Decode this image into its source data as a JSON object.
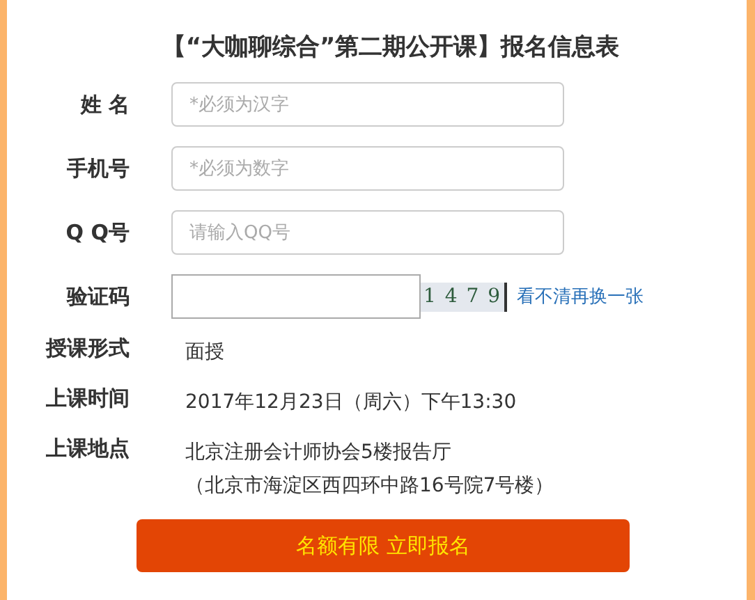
{
  "title": "【“大咖聊综合”第二期公开课】报名信息表",
  "fields": [
    {
      "label": "姓 名",
      "placeholder": "*必须为汉字",
      "kind": "text"
    },
    {
      "label": "手机号",
      "placeholder": "*必须为数字",
      "kind": "text"
    },
    {
      "label": "Q Q号",
      "placeholder": "请输入QQ号",
      "kind": "text"
    },
    {
      "label": "验证码",
      "kind": "captcha",
      "captcha": "1 4 7 9",
      "refresh_link": "看不清再换一张"
    }
  ],
  "info": [
    {
      "label": "授课形式",
      "lines": [
        "面授"
      ]
    },
    {
      "label": "上课时间",
      "lines": [
        "2017年12月23日（周六）下午13:30"
      ]
    },
    {
      "label": "上课地点",
      "lines": [
        "北京注册会计师协会5楼报告厅",
        "（北京市海淀区西四环中路16号院7号楼）"
      ]
    }
  ],
  "submit": "名额有限 立即报名"
}
